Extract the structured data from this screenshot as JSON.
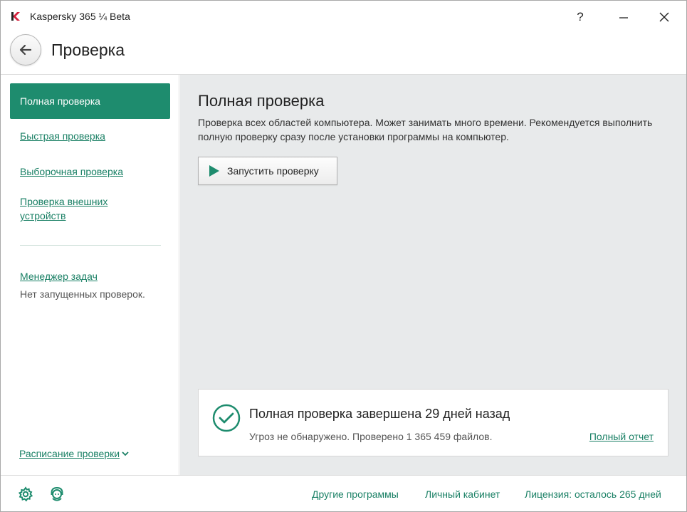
{
  "window": {
    "title": "Kaspersky 365 ¼ Beta",
    "help_label": "?"
  },
  "header": {
    "title": "Проверка"
  },
  "sidebar": {
    "items": [
      {
        "label": "Полная проверка",
        "active": true
      },
      {
        "label": "Быстрая проверка"
      },
      {
        "label": "Выборочная проверка"
      },
      {
        "label": "Проверка внешних устройств",
        "line1": "Проверка внешних",
        "line2": "устройств"
      }
    ],
    "task_manager_label": "Менеджер задач",
    "task_manager_status": "Нет запущенных проверок.",
    "schedule_label": "Расписание проверки"
  },
  "main": {
    "title": "Полная проверка",
    "description": "Проверка всех областей компьютера. Может занимать много времени. Рекомендуется выполнить полную проверку сразу после установки программы на компьютер.",
    "run_button_label": "Запустить проверку"
  },
  "result": {
    "title": "Полная проверка завершена 29 дней назад",
    "subtitle": "Угроз не обнаружено. Проверено 1 365 459 файлов.",
    "report_link": "Полный отчет"
  },
  "footer": {
    "other_programs": "Другие программы",
    "account": "Личный кабинет",
    "license": "Лицензия: осталось 265 дней"
  },
  "colors": {
    "accent": "#1e8c6e",
    "link": "#1a8065",
    "main_bg": "#e8eaeb"
  },
  "icons": [
    "kaspersky-logo-icon",
    "back-arrow-icon",
    "play-icon",
    "check-circle-icon",
    "gear-icon",
    "support-icon",
    "chevron-down-icon"
  ]
}
